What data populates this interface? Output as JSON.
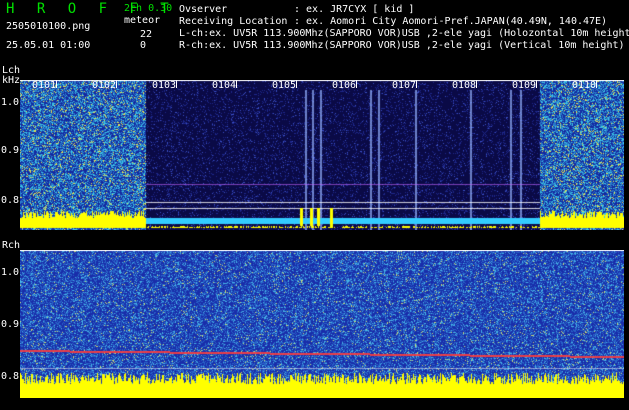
{
  "header": {
    "app_name": "H R O F F T",
    "file_name": "2505010100.png",
    "datetime": "25.05.01 01:00",
    "mode": "2ch 0.30",
    "meteor_label": "meteor",
    "meteor_count_l": "22",
    "meteor_count_r": "0",
    "observer_key": "Ovserver",
    "observer_val": ": ex. JR7CYX [ kid ]",
    "location_key": "Receiving Location",
    "location_val": ": ex. Aomori City Aomori-Pref.JAPAN(40.49N, 140.47E)",
    "lch_info": "L-ch:ex. UV5R 113.900Mhz(SAPPORO VOR)USB ,2-ele yagi (Holozontal 10m height)",
    "rch_info": "R-ch:ex. UV5R 113.900Mhz(SAPPORO VOR)USB ,2-ele yagi (Vertical 10m height)"
  },
  "lch": {
    "label": "Lch",
    "unit": "kHz",
    "yticks": [
      "1.0",
      "0.9",
      "0.8"
    ],
    "time_ticks": [
      "0101",
      "0102",
      "0103",
      "0104",
      "0105",
      "0106",
      "0107",
      "0108",
      "0109",
      "0110"
    ]
  },
  "rch": {
    "label": "Rch",
    "yticks": [
      "1.0",
      "0.9",
      "0.8"
    ]
  },
  "colors": {
    "title_green": "#00e000",
    "noise_blue": "#1a2fa0",
    "noise_cyan": "#33ccff",
    "band_yellow": "#ffff00",
    "dark_blue": "#0a0a50"
  }
}
